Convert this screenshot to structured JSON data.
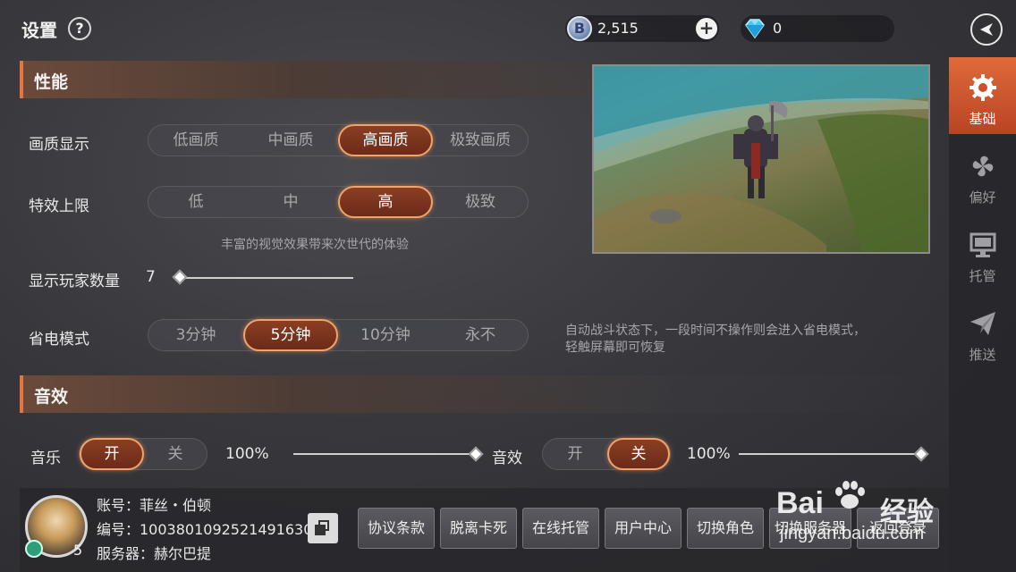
{
  "header": {
    "title": "设置",
    "help": "?",
    "currency_b": {
      "icon": "B",
      "value": "2,515",
      "add": "+"
    },
    "currency_gem": {
      "value": "0"
    }
  },
  "sidebar": {
    "items": [
      {
        "label": "基础",
        "icon": "gear-icon",
        "active": true
      },
      {
        "label": "偏好",
        "icon": "pinwheel-icon",
        "active": false
      },
      {
        "label": "托管",
        "icon": "monitor-icon",
        "active": false
      },
      {
        "label": "推送",
        "icon": "paper-plane-icon",
        "active": false
      }
    ]
  },
  "performance": {
    "section_title": "性能",
    "quality": {
      "label": "画质显示",
      "options": [
        "低画质",
        "中画质",
        "高画质",
        "极致画质"
      ],
      "selected": "高画质"
    },
    "effects": {
      "label": "特效上限",
      "options": [
        "低",
        "中",
        "高",
        "极致"
      ],
      "selected": "高",
      "hint": "丰富的视觉效果带来次世代的体验"
    },
    "players": {
      "label": "显示玩家数量",
      "value": "7"
    },
    "power_saving": {
      "label": "省电模式",
      "options": [
        "3分钟",
        "5分钟",
        "10分钟",
        "永不"
      ],
      "selected": "5分钟",
      "hint_line1": "自动战斗状态下，一段时间不操作则会进入省电模式，",
      "hint_line2": "轻触屏幕即可恢复"
    }
  },
  "sound": {
    "section_title": "音效",
    "music": {
      "label": "音乐",
      "on": "开",
      "off": "关",
      "selected": "开",
      "volume": "100%"
    },
    "sfx": {
      "label": "音效",
      "on": "开",
      "off": "关",
      "selected": "关",
      "volume": "100%"
    }
  },
  "account": {
    "level": "5",
    "account_line": "账号：菲丝・伯顿",
    "id_line": "编号：1003801092521491630",
    "server_line": "服务器：赫尔巴提",
    "buttons": [
      "协议条款",
      "脱离卡死",
      "在线托管",
      "用户中心",
      "切换角色",
      "切换服务器",
      "返回登录"
    ]
  },
  "watermark": {
    "brand": "Bai",
    "suffix": "经验",
    "url": "jingyan.baidu.com"
  },
  "colors": {
    "accent": "#e2773c",
    "selected_fill": "#7a3320",
    "sidebar_active": "#d0582e"
  }
}
